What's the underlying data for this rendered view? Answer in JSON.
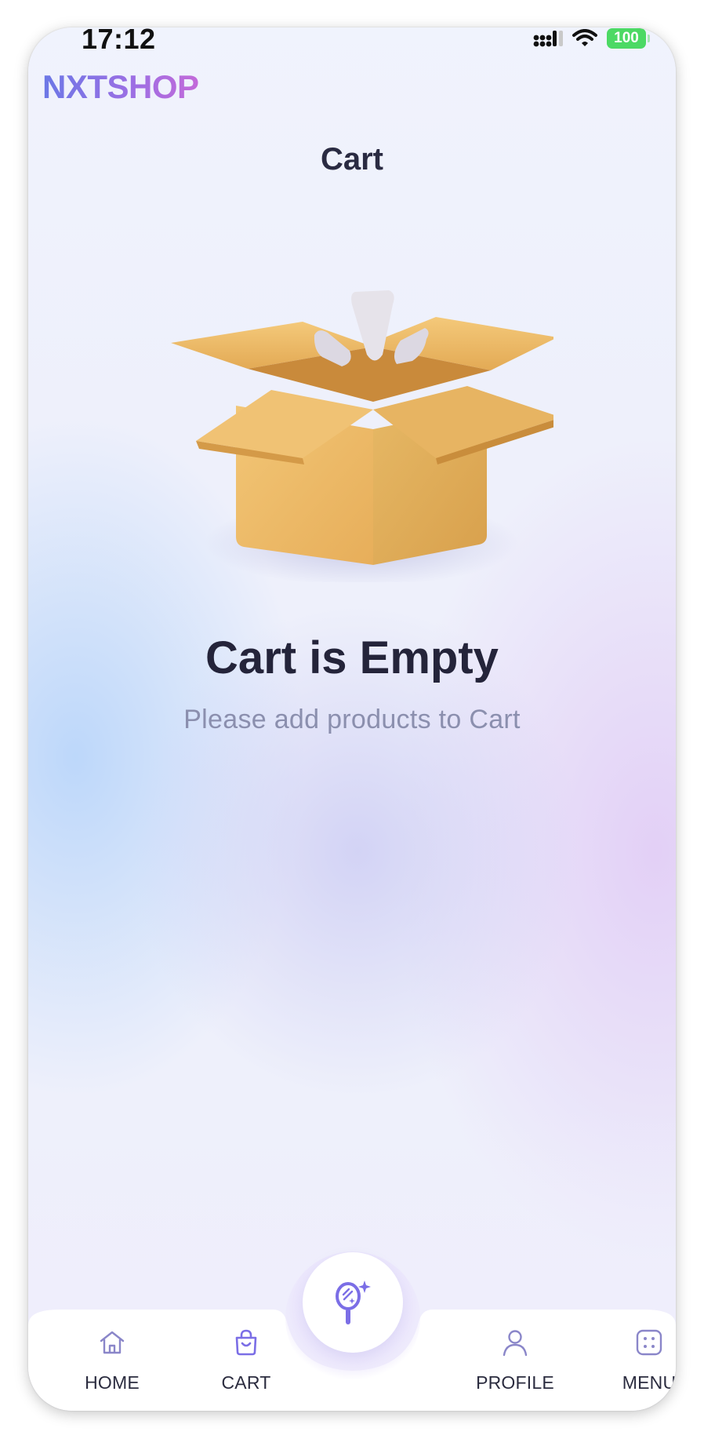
{
  "status_bar": {
    "time": "17:12",
    "battery": "100",
    "icons": [
      "signal-icon",
      "wifi-icon",
      "battery-icon"
    ]
  },
  "header": {
    "logo": "NXTSHOP",
    "page_title": "Cart"
  },
  "empty_state": {
    "illustration": "open-box-icon",
    "title": "Cart is Empty",
    "subtitle": "Please add products to Cart"
  },
  "bottom_nav": {
    "items": [
      {
        "label": "HOME",
        "icon": "home-icon"
      },
      {
        "label": "CART",
        "icon": "shopping-bag-icon"
      },
      {
        "label": "PROFILE",
        "icon": "user-icon"
      },
      {
        "label": "MENU",
        "icon": "grid-menu-icon"
      }
    ],
    "center_action_icon": "magic-mirror-icon"
  },
  "colors": {
    "accent": "#7b6ee6",
    "logo_gradient": [
      "#6c78e6",
      "#c36ad9"
    ],
    "title": "#2a2b42",
    "subtitle": "#8b8fae",
    "box": "#e9b767"
  }
}
